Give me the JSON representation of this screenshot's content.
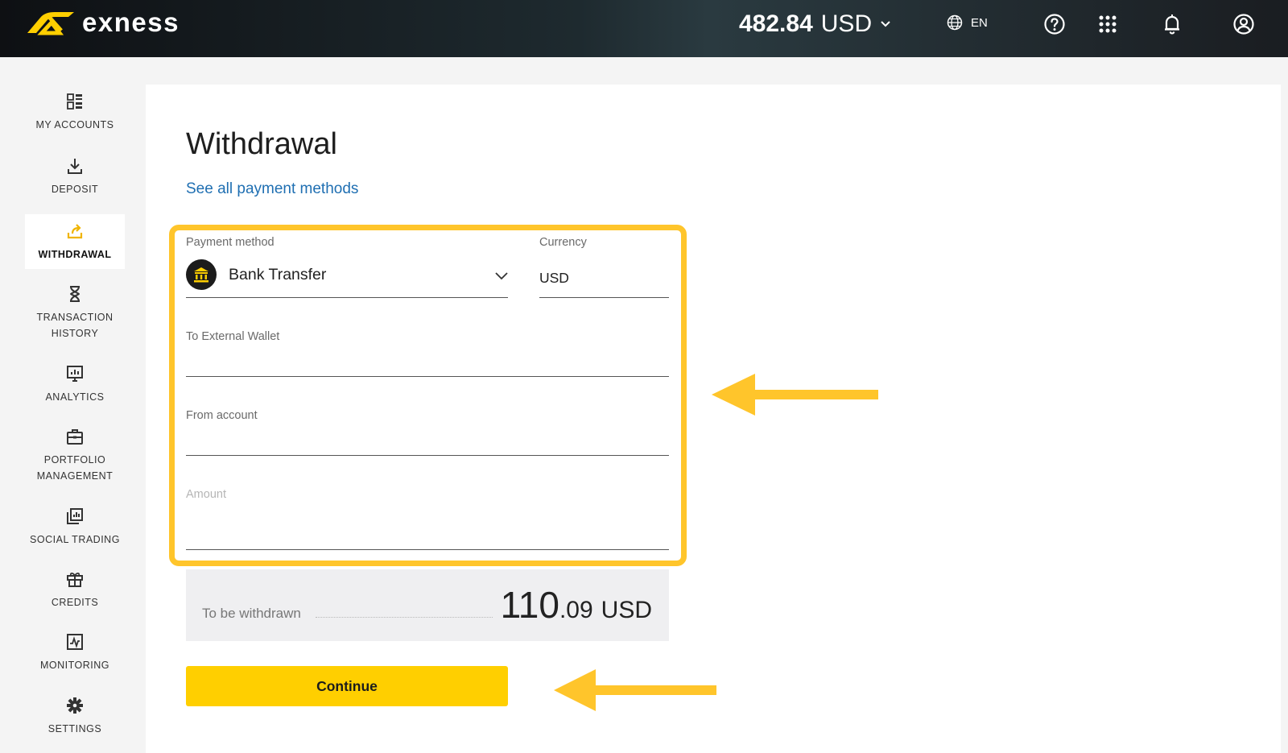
{
  "header": {
    "logo_text": "exness",
    "balance_amount": "482.84",
    "balance_currency": "USD",
    "language": "EN",
    "icons": [
      "globe-icon",
      "help-icon",
      "apps-grid-icon",
      "bell-icon",
      "user-icon"
    ]
  },
  "sidebar": {
    "items": [
      {
        "label": "MY ACCOUNTS",
        "icon": "accounts-icon"
      },
      {
        "label": "DEPOSIT",
        "icon": "deposit-icon"
      },
      {
        "label": "WITHDRAWAL",
        "icon": "withdrawal-icon",
        "active": true
      },
      {
        "label": "TRANSACTION HISTORY",
        "icon": "hourglass-icon"
      },
      {
        "label": "ANALYTICS",
        "icon": "analytics-icon"
      },
      {
        "label": "PORTFOLIO MANAGEMENT",
        "icon": "briefcase-icon"
      },
      {
        "label": "SOCIAL TRADING",
        "icon": "social-trading-icon"
      },
      {
        "label": "CREDITS",
        "icon": "gift-icon"
      },
      {
        "label": "MONITORING",
        "icon": "monitoring-icon"
      },
      {
        "label": "SETTINGS",
        "icon": "gear-icon"
      }
    ]
  },
  "main": {
    "title": "Withdrawal",
    "see_all_link": "See all payment methods",
    "form": {
      "payment_method_label": "Payment method",
      "payment_method_value": "Bank Transfer",
      "currency_label": "Currency",
      "currency_value": "USD",
      "external_wallet_label": "To External Wallet",
      "from_account_label": "From account",
      "amount_label": "Amount"
    },
    "summary": {
      "label": "To be withdrawn",
      "amount_int": "110",
      "amount_dec": ".09",
      "currency": "USD"
    },
    "continue_label": "Continue"
  },
  "colors": {
    "accent_yellow": "#ffcf00",
    "highlight_border": "#ffc52b",
    "link_blue": "#1f6fb2",
    "topbar_dark": "#14181c"
  }
}
